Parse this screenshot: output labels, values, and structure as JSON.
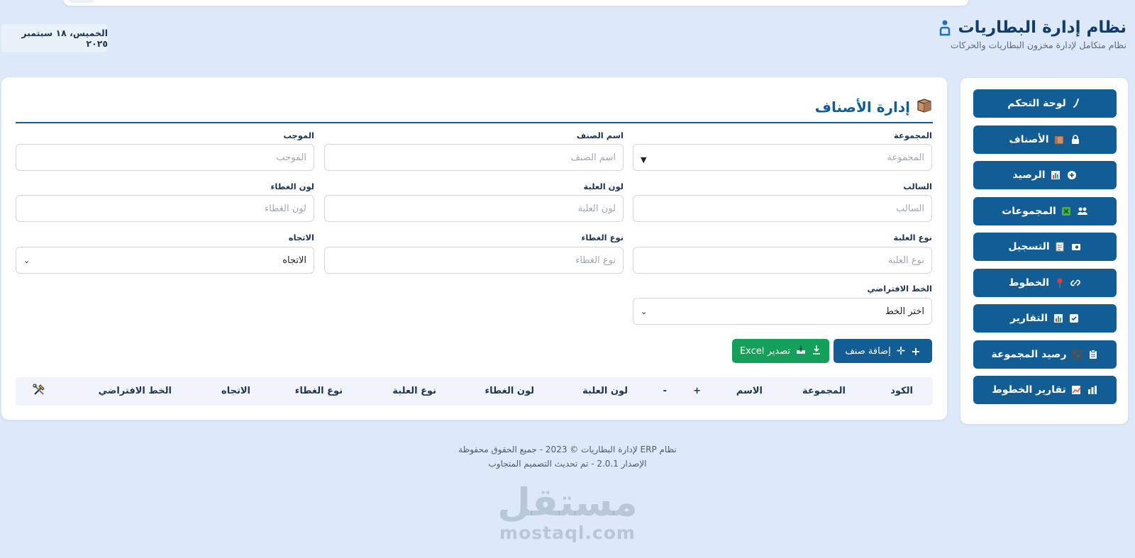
{
  "header": {
    "title": "نظام إدارة البطاريات",
    "subtitle": "نظام متكامل لإدارة مخزون البطاريات والحركات",
    "date": "الخميس، ١٨ سبتمبر ٢٠٢٥"
  },
  "sidebar": {
    "items": [
      {
        "label": "لوحة التحكم",
        "icon": "wrench-icon",
        "emoji": ""
      },
      {
        "label": "الأصناف",
        "icon": "lock-icon",
        "emoji": "box-emoji"
      },
      {
        "label": "الرصيد",
        "icon": "plus-circle-icon",
        "emoji": "chart-emoji"
      },
      {
        "label": "المجموعات",
        "icon": "users-icon",
        "emoji": "cross-emoji"
      },
      {
        "label": "التسجيل",
        "icon": "camera-icon",
        "emoji": "memo-emoji"
      },
      {
        "label": "الخطوط",
        "icon": "link-icon",
        "emoji": "pin-emoji"
      },
      {
        "label": "التقارير",
        "icon": "check-icon",
        "emoji": "chart-emoji"
      },
      {
        "label": "رصيد المجموعة",
        "icon": "clipboard-icon",
        "emoji": "abacus-emoji"
      },
      {
        "label": "تقارير الخطوط",
        "icon": "bars-icon",
        "emoji": "chart-emoji"
      }
    ]
  },
  "main": {
    "title": "إدارة الأصناف",
    "fields": {
      "group": {
        "label": "المجموعة",
        "placeholder": "المجموعة"
      },
      "name": {
        "label": "اسم الصنف",
        "placeholder": "اسم الصنف"
      },
      "positive": {
        "label": "الموجب",
        "placeholder": "الموجب"
      },
      "negative": {
        "label": "السالب",
        "placeholder": "السالب"
      },
      "can_color": {
        "label": "لون العلبة",
        "placeholder": "لون العلبة"
      },
      "lid_color": {
        "label": "لون الغطاء",
        "placeholder": "لون الغطاء"
      },
      "can_type": {
        "label": "نوع العلبة",
        "placeholder": "نوع العلبة"
      },
      "lid_type": {
        "label": "نوع الغطاء",
        "placeholder": "نوع الغطاء"
      },
      "direction": {
        "label": "الاتجاه",
        "value": "الاتجاه"
      },
      "default_line": {
        "label": "الخط الافتراضي",
        "value": "اختر الخط"
      }
    },
    "buttons": {
      "add": "إضافة صنف",
      "export": "تصدير Excel"
    },
    "table": {
      "columns": [
        "الكود",
        "المجموعة",
        "الاسم",
        "+",
        "-",
        "لون العلبة",
        "لون الغطاء",
        "نوع العلبة",
        "نوع الغطاء",
        "الاتجاه",
        "الخط الافتراضي"
      ]
    }
  },
  "footer": {
    "line1": "نظام ERP لإدارة البطاريات © 2023 - جميع الحقوق محفوظة",
    "line2": "الإصدار 2.0.1 - تم تحديث التصميم المتجاوب"
  },
  "watermark": {
    "arabic": "مستقل",
    "latin": "mostaql.com"
  },
  "colors": {
    "primary": "#135d95",
    "excel": "#14a05a",
    "background": "#dde9f8"
  }
}
